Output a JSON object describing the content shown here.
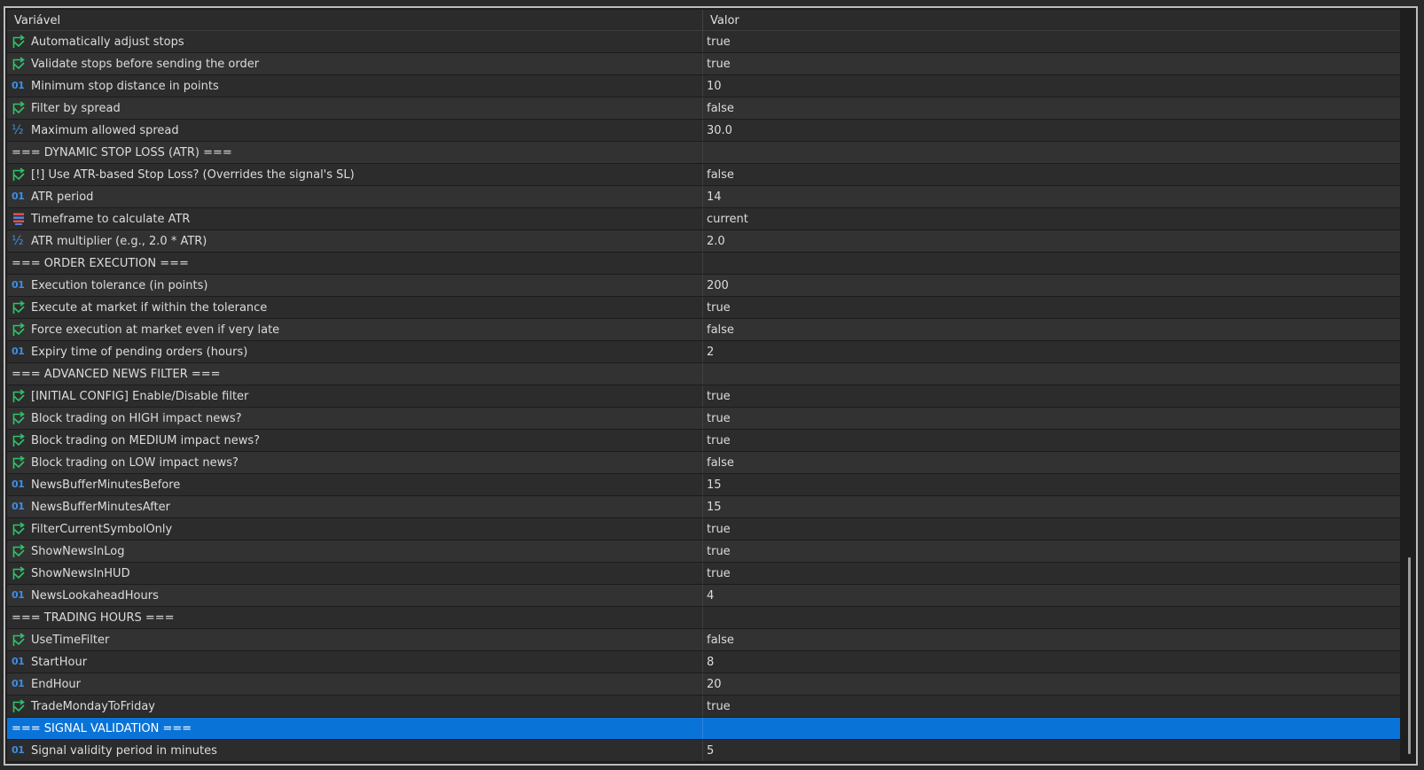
{
  "header": {
    "col_name": "Variável",
    "col_value": "Valor"
  },
  "rows": [
    {
      "type": "bool",
      "name": "Automatically adjust stops",
      "value": "true"
    },
    {
      "type": "bool",
      "name": "Validate stops before sending the order",
      "value": "true"
    },
    {
      "type": "int",
      "name": "Minimum stop distance in points",
      "value": "10"
    },
    {
      "type": "bool",
      "name": "Filter by spread",
      "value": "false"
    },
    {
      "type": "double",
      "name": "Maximum allowed spread",
      "value": "30.0"
    },
    {
      "type": "section",
      "name": "=== DYNAMIC STOP LOSS (ATR) ===",
      "value": ""
    },
    {
      "type": "bool",
      "name": "[!] Use ATR-based Stop Loss? (Overrides the signal's SL)",
      "value": "false"
    },
    {
      "type": "int",
      "name": "ATR period",
      "value": "14"
    },
    {
      "type": "enum",
      "name": "Timeframe to calculate ATR",
      "value": "current"
    },
    {
      "type": "double",
      "name": "ATR multiplier (e.g., 2.0 * ATR)",
      "value": "2.0"
    },
    {
      "type": "section",
      "name": "=== ORDER EXECUTION ===",
      "value": ""
    },
    {
      "type": "int",
      "name": "Execution tolerance (in points)",
      "value": "200"
    },
    {
      "type": "bool",
      "name": "Execute at market if within the tolerance",
      "value": "true"
    },
    {
      "type": "bool",
      "name": "Force execution at market even if very late",
      "value": "false"
    },
    {
      "type": "int",
      "name": "Expiry time of pending orders (hours)",
      "value": "2"
    },
    {
      "type": "section",
      "name": "=== ADVANCED NEWS FILTER ===",
      "value": ""
    },
    {
      "type": "bool",
      "name": "[INITIAL CONFIG] Enable/Disable filter",
      "value": "true"
    },
    {
      "type": "bool",
      "name": "Block trading on HIGH impact news?",
      "value": "true"
    },
    {
      "type": "bool",
      "name": "Block trading on MEDIUM impact news?",
      "value": "true"
    },
    {
      "type": "bool",
      "name": "Block trading on LOW impact news?",
      "value": "false"
    },
    {
      "type": "int",
      "name": "NewsBufferMinutesBefore",
      "value": "15"
    },
    {
      "type": "int",
      "name": "NewsBufferMinutesAfter",
      "value": "15"
    },
    {
      "type": "bool",
      "name": "FilterCurrentSymbolOnly",
      "value": "true"
    },
    {
      "type": "bool",
      "name": "ShowNewsInLog",
      "value": "true"
    },
    {
      "type": "bool",
      "name": "ShowNewsInHUD",
      "value": "true"
    },
    {
      "type": "int",
      "name": "NewsLookaheadHours",
      "value": "4"
    },
    {
      "type": "section",
      "name": "=== TRADING HOURS ===",
      "value": ""
    },
    {
      "type": "bool",
      "name": "UseTimeFilter",
      "value": "false"
    },
    {
      "type": "int",
      "name": "StartHour",
      "value": "8"
    },
    {
      "type": "int",
      "name": "EndHour",
      "value": "20"
    },
    {
      "type": "bool",
      "name": "TradeMondayToFriday",
      "value": "true"
    },
    {
      "type": "section",
      "name": "=== SIGNAL VALIDATION ===",
      "value": "",
      "selected": true
    },
    {
      "type": "int",
      "name": "Signal validity period in minutes",
      "value": "5"
    }
  ],
  "icons": {
    "int": "int-icon",
    "bool": "bool-icon",
    "double": "double-icon",
    "enum": "enum-icon"
  },
  "icon_glyphs": {
    "int": "01",
    "double": "½"
  },
  "colors": {
    "selection": "#0a73d8",
    "bool_icon": "#2ec46a",
    "num_icon": "#3d8ee6"
  }
}
